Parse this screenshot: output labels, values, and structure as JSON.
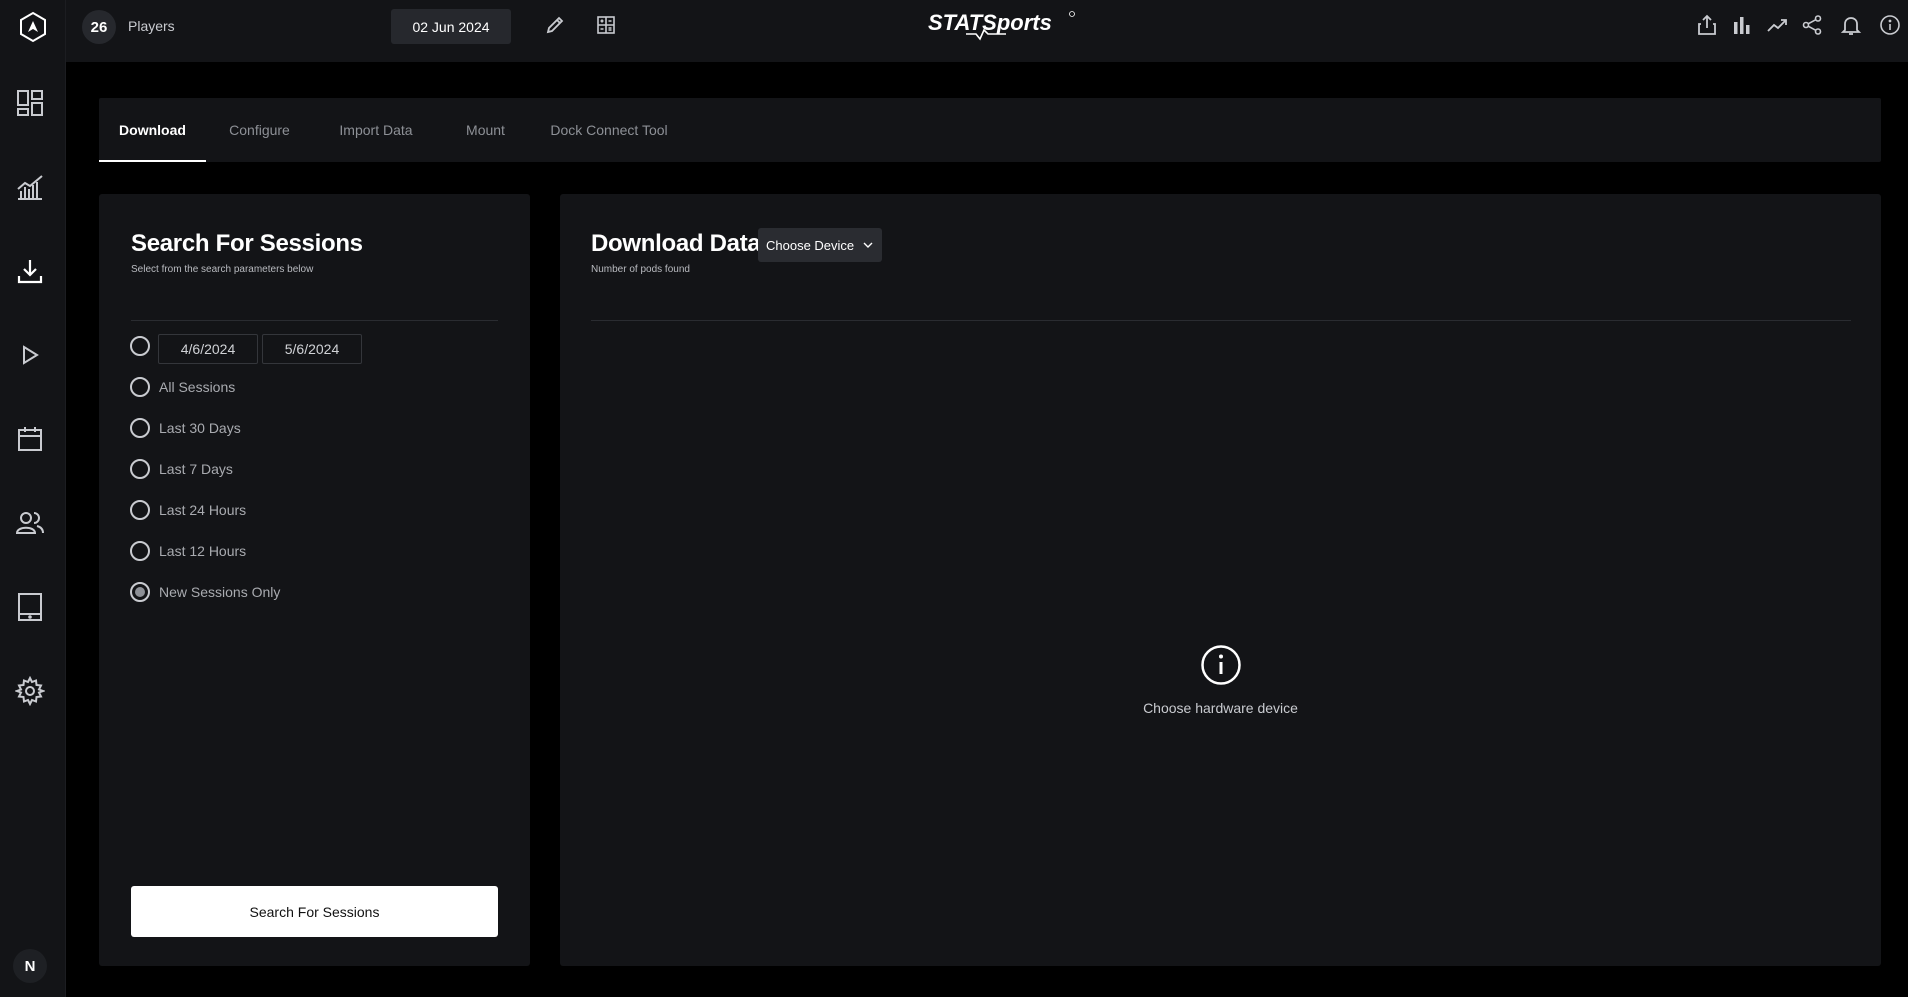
{
  "topbar": {
    "player_count": "26",
    "players_label": "Players",
    "date": "02 Jun 2024",
    "brand": "STATSports"
  },
  "sidebar": {
    "avatar_initial": "N",
    "items": [
      {
        "icon": "dashboard-icon"
      },
      {
        "icon": "analytics-icon"
      },
      {
        "icon": "download-icon"
      },
      {
        "icon": "play-icon"
      },
      {
        "icon": "calendar-icon"
      },
      {
        "icon": "users-icon"
      },
      {
        "icon": "tablet-icon"
      },
      {
        "icon": "gear-icon"
      }
    ]
  },
  "tabs": [
    {
      "label": "Download",
      "active": true
    },
    {
      "label": "Configure"
    },
    {
      "label": "Import Data"
    },
    {
      "label": "Mount"
    },
    {
      "label": "Dock Connect Tool"
    }
  ],
  "search_panel": {
    "title": "Search For Sessions",
    "subtitle": "Select from the search parameters below",
    "date_from": "4/6/2024",
    "date_to": "5/6/2024",
    "options": [
      {
        "label": "All Sessions",
        "checked": false
      },
      {
        "label": "Last 30 Days",
        "checked": false
      },
      {
        "label": "Last 7 Days",
        "checked": false
      },
      {
        "label": "Last 24 Hours",
        "checked": false
      },
      {
        "label": "Last 12 Hours",
        "checked": false
      },
      {
        "label": "New Sessions Only",
        "checked": true
      }
    ],
    "button_label": "Search For Sessions"
  },
  "download_panel": {
    "title": "Download Data",
    "subtitle": "Number of pods found",
    "device_select": "Choose Device",
    "empty_message": "Choose hardware device"
  },
  "colors": {
    "background": "#000000",
    "panel": "#131417",
    "accent": "#ffffff"
  }
}
